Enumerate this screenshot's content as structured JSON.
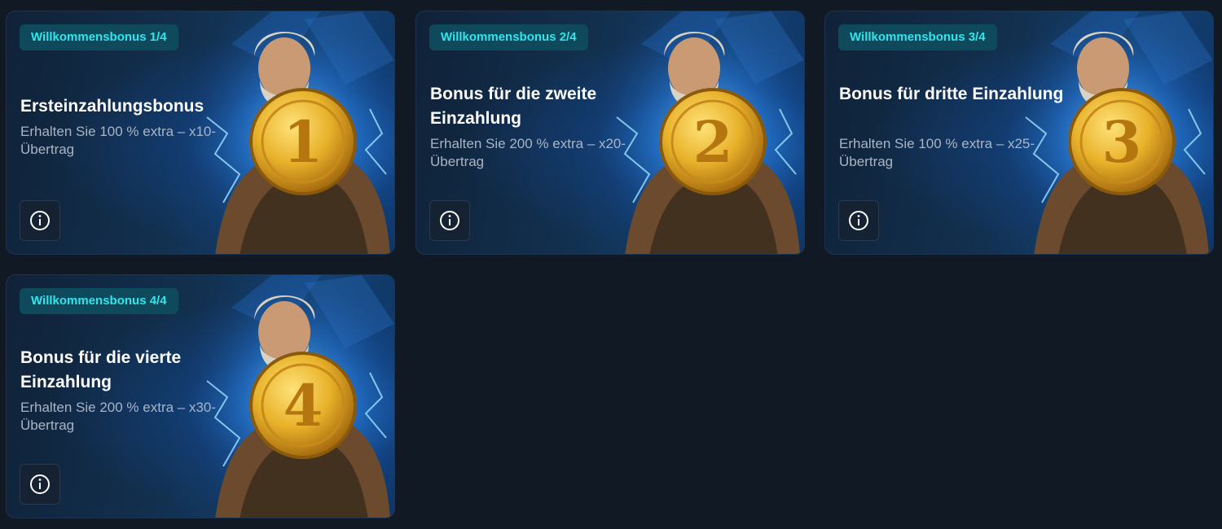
{
  "cards": [
    {
      "badge": "Willkommensbonus 1/4",
      "title": "Ersteinzahlungsbonus",
      "desc": "Erhalten Sie 100 % extra – x10-Übertrag",
      "coin_number": "1"
    },
    {
      "badge": "Willkommensbonus 2/4",
      "title": "Bonus für die zweite Einzahlung",
      "desc": "Erhalten Sie 200 % extra – x20-Übertrag",
      "coin_number": "2"
    },
    {
      "badge": "Willkommensbonus 3/4",
      "title": "Bonus für dritte Einzahlung",
      "desc": "Erhalten Sie 100 % extra – x25-Übertrag",
      "coin_number": "3"
    },
    {
      "badge": "Willkommensbonus 4/4",
      "title": "Bonus für die vierte Einzahlung",
      "desc": "Erhalten Sie 200 % extra – x30-Übertrag",
      "coin_number": "4"
    }
  ],
  "icons": {
    "info": "info-icon",
    "art": "zeus-coin-illustration"
  },
  "colors": {
    "page_background": "#111a24",
    "badge_text": "#2fe6ec",
    "badge_background": "#0f4a5c",
    "title": "#ffffff",
    "description": "#a9b5c4",
    "coin_gold": "#e8b22a"
  }
}
